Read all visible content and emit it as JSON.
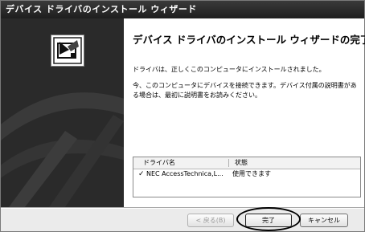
{
  "window": {
    "title": "デバイス ドライバのインストール ウィザード"
  },
  "wizard": {
    "heading": "デバイス ドライバのインストール ウィザードの完了",
    "message1": "ドライバは、正しくこのコンピュータにインストールされました。",
    "message2": "今、このコンピュータにデバイスを接続できます。デバイス付属の説明書がある場合は、最初に説明書をお読みください。"
  },
  "driver_list": {
    "columns": [
      "ドライバ名",
      "状態"
    ],
    "rows": [
      {
        "name": "NEC AccessTechnica,L...",
        "status": "使用できます"
      }
    ]
  },
  "buttons": {
    "back": "< 戻る(B)",
    "finish": "完了",
    "cancel": "キャンセル"
  },
  "icons": {
    "wizard": "install-box-icon",
    "row_check": "check-icon"
  }
}
